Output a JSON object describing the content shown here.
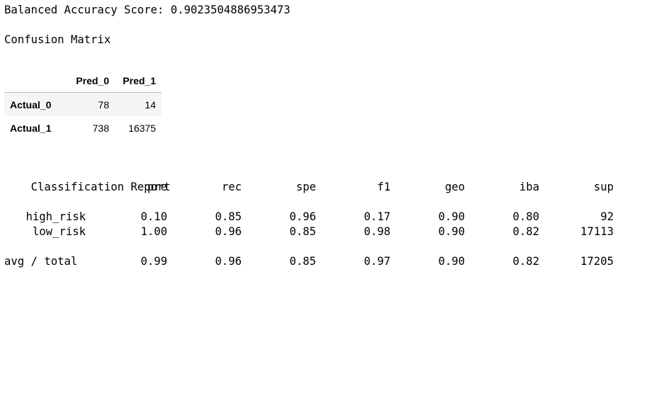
{
  "output": {
    "balanced_accuracy_line": "Balanced Accuracy Score: 0.9023504886953473",
    "confusion_matrix_title": "Confusion Matrix",
    "confusion_matrix": {
      "columns": [
        "Pred_0",
        "Pred_1"
      ],
      "rows": [
        {
          "label": "Actual_0",
          "values": [
            "78",
            "14"
          ]
        },
        {
          "label": "Actual_1",
          "values": [
            "738",
            "16375"
          ]
        }
      ]
    },
    "classification_report": {
      "title": "Classification Report",
      "headers": [
        "pre",
        "rec",
        "spe",
        "f1",
        "geo",
        "iba",
        "sup"
      ],
      "rows": [
        {
          "label": "high_risk",
          "values": [
            "0.10",
            "0.85",
            "0.96",
            "0.17",
            "0.90",
            "0.80",
            "92"
          ]
        },
        {
          "label": "low_risk",
          "values": [
            "1.00",
            "0.96",
            "0.85",
            "0.98",
            "0.90",
            "0.82",
            "17113"
          ]
        }
      ],
      "total": {
        "label": "avg / total",
        "values": [
          "0.99",
          "0.96",
          "0.85",
          "0.97",
          "0.90",
          "0.82",
          "17205"
        ]
      }
    }
  }
}
